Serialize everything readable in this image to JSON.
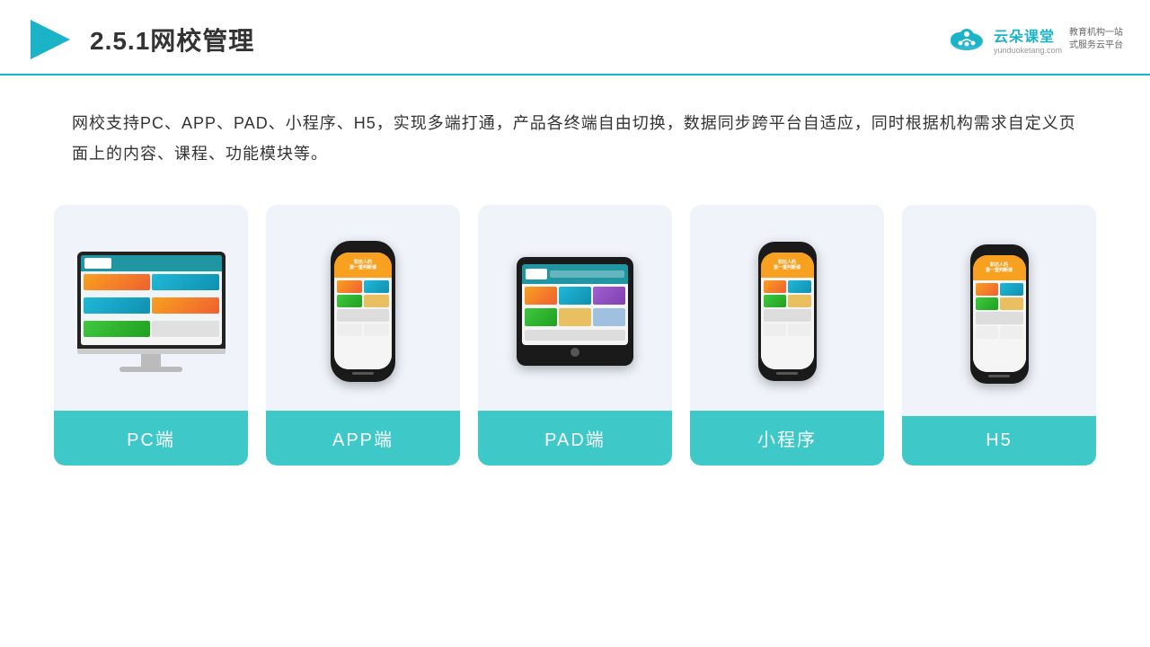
{
  "header": {
    "title": "2.5.1网校管理",
    "brand": {
      "name": "云朵课堂",
      "url": "yunduoketang.com",
      "slogan": "教育机构一站\n式服务云平台"
    }
  },
  "description": {
    "text": "网校支持PC、APP、PAD、小程序、H5，实现多端打通，产品各终端自由切换，数据同步跨平台自适应，同时根据机构需求自定义页面上的内容、课程、功能模块等。"
  },
  "cards": [
    {
      "id": "pc",
      "label": "PC端"
    },
    {
      "id": "app",
      "label": "APP端"
    },
    {
      "id": "pad",
      "label": "PAD端"
    },
    {
      "id": "mini",
      "label": "小程序"
    },
    {
      "id": "h5",
      "label": "H5"
    }
  ]
}
